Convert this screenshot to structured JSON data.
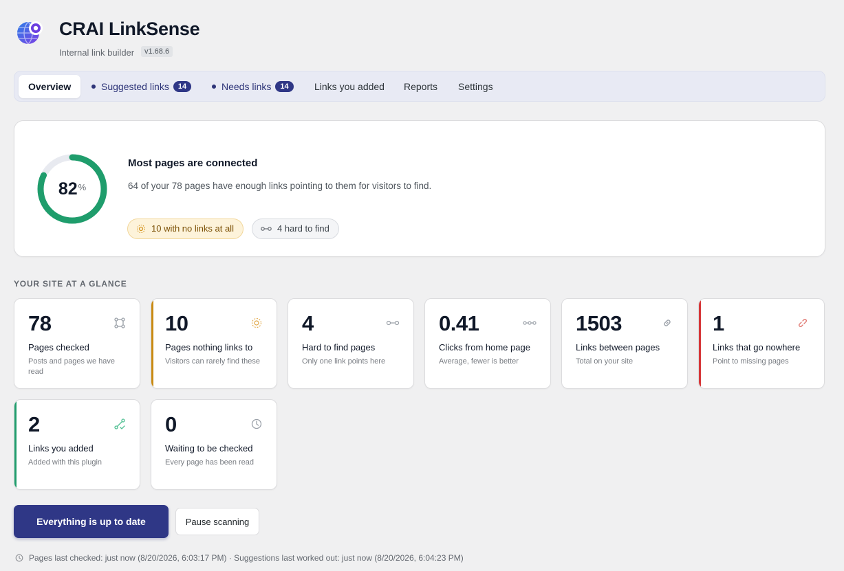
{
  "app": {
    "title": "CRAI LinkSense",
    "subtitle": "Internal link builder",
    "version": "v1.68.6",
    "logo_icon": "globe-target-icon"
  },
  "tabs": [
    {
      "label": "Overview",
      "active": true
    },
    {
      "label": "Suggested links",
      "badge": "14"
    },
    {
      "label": "Needs links",
      "badge": "14"
    },
    {
      "label": "Links you added"
    },
    {
      "label": "Reports"
    },
    {
      "label": "Settings"
    }
  ],
  "summary": {
    "percent": "82",
    "percent_sign": "%",
    "heading": "Most pages are connected",
    "text": "64 of your 78 pages have enough links pointing to them for visitors to find.",
    "pills": [
      {
        "label": "10 with no links at all",
        "icon": "sun-icon"
      },
      {
        "label": "4 hard to find",
        "icon": "chain-icon"
      }
    ]
  },
  "section_title": "YOUR SITE AT A GLANCE",
  "stats": [
    {
      "value": "78",
      "label": "Pages checked",
      "desc": "Posts and pages we have read",
      "icon": "nodes-icon"
    },
    {
      "value": "10",
      "label": "Pages nothing links to",
      "desc": "Visitors can rarely find these",
      "icon": "sun-icon"
    },
    {
      "value": "4",
      "label": "Hard to find pages",
      "desc": "Only one link points here",
      "icon": "chain-icon"
    },
    {
      "value": "0.41",
      "label": "Clicks from home page",
      "desc": "Average, fewer is better",
      "icon": "dots-chain-icon"
    },
    {
      "value": "1503",
      "label": "Links between pages",
      "desc": "Total on your site",
      "icon": "link-icon"
    },
    {
      "value": "1",
      "label": "Links that go nowhere",
      "desc": "Point to missing pages",
      "icon": "broken-link-icon"
    },
    {
      "value": "2",
      "label": "Links you added",
      "desc": "Added with this plugin",
      "icon": "route-icon"
    },
    {
      "value": "0",
      "label": "Waiting to be checked",
      "desc": "Every page has been read",
      "icon": "clock-icon"
    }
  ],
  "colors": {
    "accent": "#2f3786",
    "ring": "#1f9d6c",
    "warning": "#c98a12",
    "danger": "#d63638",
    "success": "#1f9d6c"
  },
  "actions": {
    "primary": "Everything is up to date",
    "secondary": "Pause scanning"
  },
  "footer": {
    "status": "Pages last checked: just now (8/20/2026, 6:03:17 PM) · Suggestions last worked out: just now (8/20/2026, 6:04:23 PM)"
  }
}
